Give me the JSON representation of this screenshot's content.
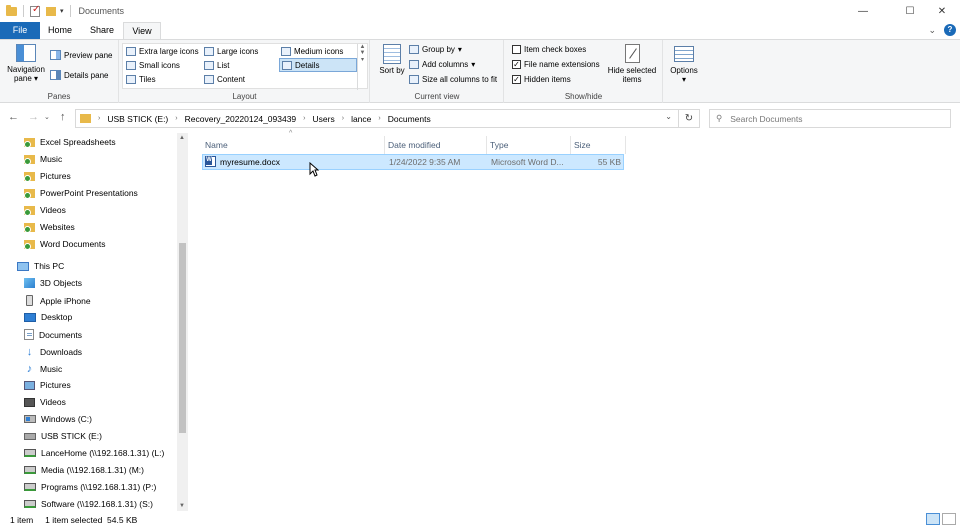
{
  "window": {
    "title": "Documents",
    "controls": {
      "minimize": "—",
      "maximize": "☐",
      "close": "✕"
    }
  },
  "ribbon_tabs": [
    "File",
    "Home",
    "Share",
    "View"
  ],
  "active_tab": "View",
  "help": {
    "expand": "⌄",
    "help": "?"
  },
  "ribbon": {
    "panes": {
      "label": "Panes",
      "navigation_pane": "Navigation pane",
      "preview_pane": "Preview pane",
      "details_pane": "Details pane"
    },
    "layout": {
      "label": "Layout",
      "options": [
        "Extra large icons",
        "Large icons",
        "Medium icons",
        "Small icons",
        "List",
        "Details",
        "Tiles",
        "Content"
      ],
      "selected": "Details"
    },
    "current_view": {
      "label": "Current view",
      "sort_by": "Sort by",
      "group_by": "Group by",
      "add_columns": "Add columns",
      "size_all_columns": "Size all columns to fit"
    },
    "show_hide": {
      "label": "Show/hide",
      "item_check_boxes": {
        "label": "Item check boxes",
        "checked": false
      },
      "file_name_extensions": {
        "label": "File name extensions",
        "checked": true
      },
      "hidden_items": {
        "label": "Hidden items",
        "checked": true
      },
      "hide_selected": "Hide selected items"
    },
    "options": "Options"
  },
  "address": {
    "breadcrumbs": [
      "USB STICK (E:)",
      "Recovery_20220124_093439",
      "Users",
      "lance",
      "Documents"
    ],
    "search_placeholder": "Search Documents"
  },
  "nav_pane": {
    "items": [
      {
        "label": "Excel Spreadsheets",
        "icon": "folder-icon"
      },
      {
        "label": "Music",
        "icon": "folder-icon"
      },
      {
        "label": "Pictures",
        "icon": "folder-icon"
      },
      {
        "label": "PowerPoint Presentations",
        "icon": "folder-icon"
      },
      {
        "label": "Videos",
        "icon": "folder-icon"
      },
      {
        "label": "Websites",
        "icon": "folder-icon"
      },
      {
        "label": "Word Documents",
        "icon": "folder-icon"
      },
      {
        "label": "This PC",
        "icon": "computer-icon"
      },
      {
        "label": "3D Objects",
        "icon": "3d-objects-icon"
      },
      {
        "label": "Apple iPhone",
        "icon": "phone-icon"
      },
      {
        "label": "Desktop",
        "icon": "desktop-icon"
      },
      {
        "label": "Documents",
        "icon": "documents-icon"
      },
      {
        "label": "Downloads",
        "icon": "downloads-icon"
      },
      {
        "label": "Music",
        "icon": "music-icon"
      },
      {
        "label": "Pictures",
        "icon": "pictures-icon"
      },
      {
        "label": "Videos",
        "icon": "videos-icon"
      },
      {
        "label": "Windows (C:)",
        "icon": "drive-icon"
      },
      {
        "label": "USB STICK (E:)",
        "icon": "usb-drive-icon"
      },
      {
        "label": "LanceHome (\\\\192.168.1.31) (L:)",
        "icon": "network-drive-icon"
      },
      {
        "label": "Media (\\\\192.168.1.31) (M:)",
        "icon": "network-drive-icon"
      },
      {
        "label": "Programs (\\\\192.168.1.31) (P:)",
        "icon": "network-drive-icon"
      },
      {
        "label": "Software (\\\\192.168.1.31) (S:)",
        "icon": "network-drive-icon"
      }
    ]
  },
  "file_list": {
    "columns": [
      "Name",
      "Date modified",
      "Type",
      "Size"
    ],
    "rows": [
      {
        "name": "myresume.docx",
        "date_modified": "1/24/2022 9:35 AM",
        "type": "Microsoft Word D...",
        "size": "55 KB",
        "selected": true
      }
    ]
  },
  "status_bar": {
    "item_count": "1 item",
    "selection": "1 item selected  54.5 KB"
  },
  "colors": {
    "file_tab": "#1a6ab8",
    "selection_bg": "#cce8ff",
    "selection_border": "#99d1ff"
  }
}
